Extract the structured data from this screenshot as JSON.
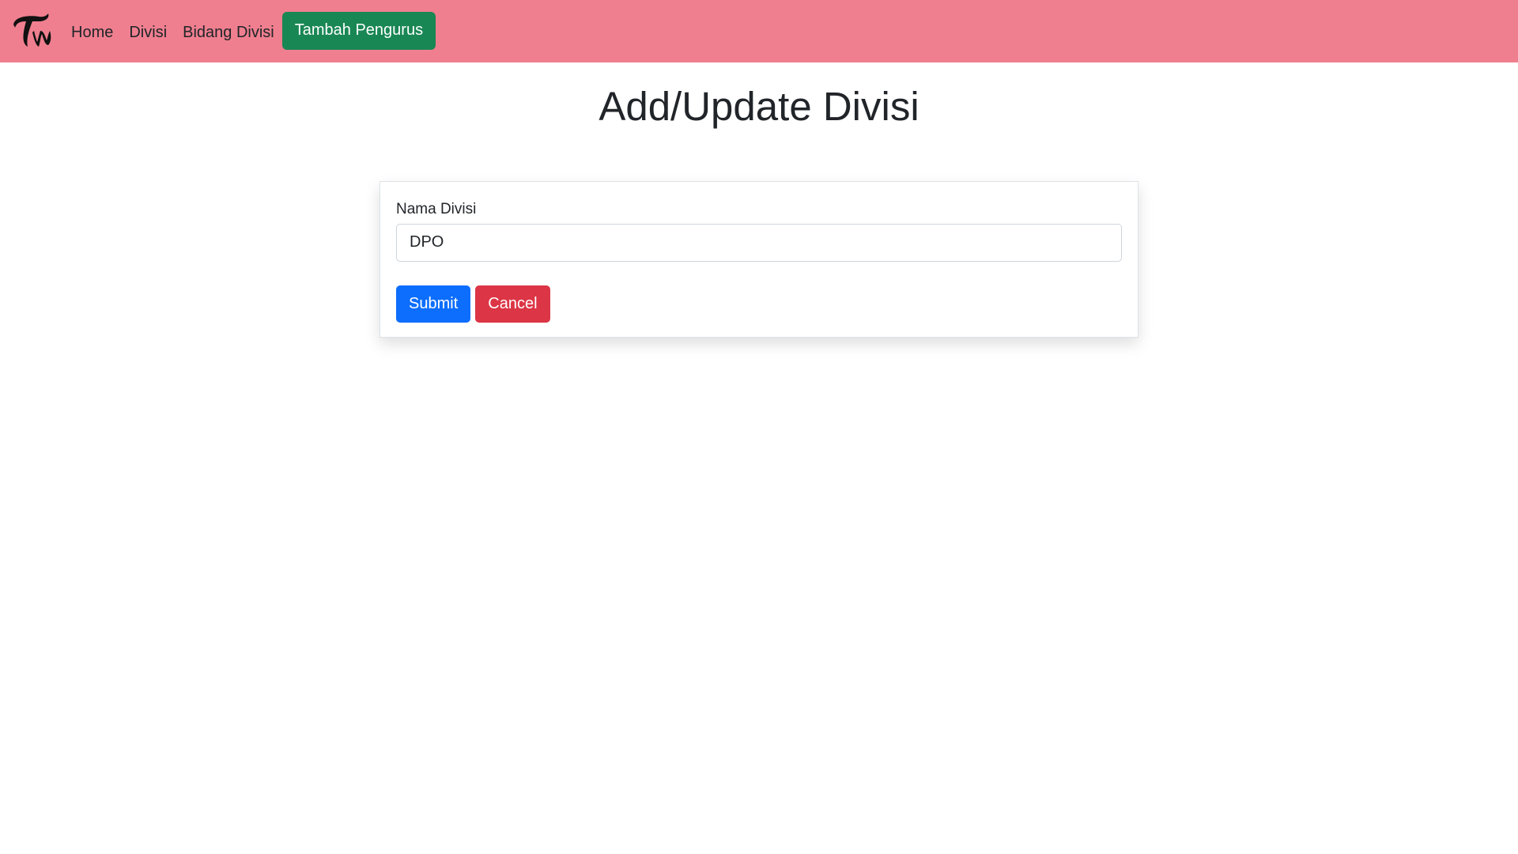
{
  "navbar": {
    "logo_icon": "twice-logo-icon",
    "links": [
      {
        "label": "Home"
      },
      {
        "label": "Divisi"
      },
      {
        "label": "Bidang Divisi"
      }
    ],
    "action_label": "Tambah Pengurus",
    "background_color": "#ef7f8f",
    "action_color": "#198754"
  },
  "page": {
    "title": "Add/Update Divisi"
  },
  "form": {
    "nama_divisi_label": "Nama Divisi",
    "nama_divisi_value": "DPO",
    "submit_label": "Submit",
    "cancel_label": "Cancel",
    "submit_color": "#0d6efd",
    "cancel_color": "#dc3545"
  }
}
